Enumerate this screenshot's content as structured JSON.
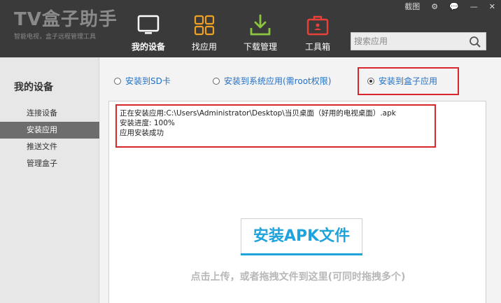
{
  "app": {
    "logo_title": "TV盒子助手",
    "logo_subtitle": "智能电视，盒子远程管理工具"
  },
  "nav": [
    {
      "label": "我的设备",
      "icon": "tv-icon",
      "active": true
    },
    {
      "label": "找应用",
      "icon": "grid-icon",
      "active": false
    },
    {
      "label": "下载管理",
      "icon": "download-icon",
      "active": false
    },
    {
      "label": "工具箱",
      "icon": "toolbox-icon",
      "active": false
    }
  ],
  "window_controls": {
    "screenshot": "截图",
    "settings_icon": "gear-icon",
    "feedback_icon": "chat-icon",
    "minimize": "—",
    "close": "✕"
  },
  "search": {
    "placeholder": "搜索应用",
    "icon": "search-icon"
  },
  "sidebar": {
    "title": "我的设备",
    "items": [
      {
        "label": "连接设备",
        "active": false
      },
      {
        "label": "安装应用",
        "active": true
      },
      {
        "label": "推送文件",
        "active": false
      },
      {
        "label": "管理盒子",
        "active": false
      }
    ]
  },
  "install_options": [
    {
      "label": "安装到SD卡",
      "checked": false
    },
    {
      "label": "安装到系统应用(需root权限)",
      "checked": false
    },
    {
      "label": "安装到盒子应用",
      "checked": true
    }
  ],
  "log": {
    "line1": "正在安装应用:C:\\Users\\Administrator\\Desktop\\当贝桌面（好用的电视桌面）.apk",
    "line2": "安装进度:  100%",
    "line3": "应用安装成功"
  },
  "install_button": "安装APK文件",
  "hint": "点击上传，或者拖拽文件到这里(可同时拖拽多个)",
  "colors": {
    "topbar": "#3a3a3a",
    "accent": "#1ea3dc",
    "highlight": "#d9262c",
    "option_text": "#2470c5"
  }
}
